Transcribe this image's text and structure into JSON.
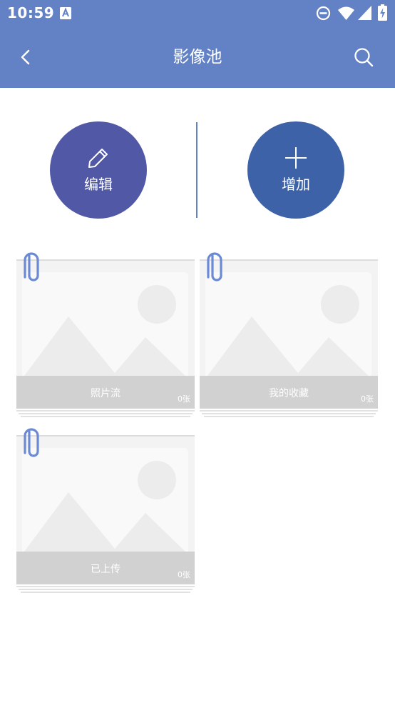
{
  "status_bar": {
    "time": "10:59"
  },
  "header": {
    "title": "影像池"
  },
  "actions": {
    "edit_label": "编辑",
    "add_label": "增加"
  },
  "albums": [
    {
      "name": "照片流",
      "count": "0张"
    },
    {
      "name": "我的收藏",
      "count": "0张"
    },
    {
      "name": "已上传",
      "count": "0张"
    }
  ],
  "colors": {
    "header": "#6382c6",
    "edit_button": "#5159a7",
    "add_button": "#3d62a8",
    "clip": "#6b8ad3",
    "caption_bar": "#d1d1d1"
  }
}
